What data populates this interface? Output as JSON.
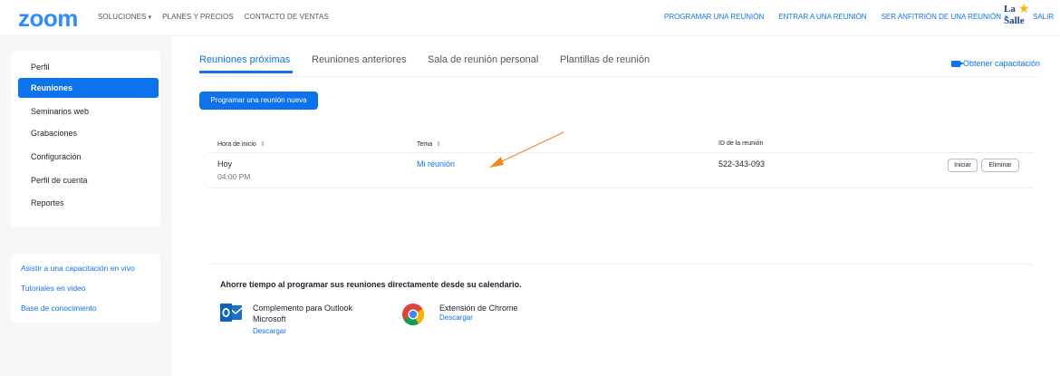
{
  "nav": {
    "logo": "zoom",
    "left": [
      "SOLUCIONES",
      "PLANES Y PRECIOS",
      "CONTACTO DE VENTAS"
    ],
    "right": [
      "PROGRAMAR UNA REUNIÓN",
      "ENTRAR A UNA REUNIÓN",
      "SER ANFITRIÓN DE UNA REUNIÓN"
    ],
    "brand_la": "La",
    "brand_salle": "Salle",
    "logout": "SALIR"
  },
  "sidebar": {
    "items": [
      "Perfil",
      "Reuniones",
      "Seminarios web",
      "Grabaciones",
      "Configuración",
      "Perfil de cuenta",
      "Reportes"
    ],
    "active": "Reuniones",
    "links": [
      "Asistir a una capacitación en vivo",
      "Tutoriales en video",
      "Base de conocimiento"
    ]
  },
  "tabs": [
    "Reuniones próximas",
    "Reuniones anteriores",
    "Sala de reunión personal",
    "Plantillas de reunión"
  ],
  "training_label": "Obtener capacitación",
  "new_meeting_button": "Programar una reunión nueva",
  "table": {
    "headers": [
      "Hora de inicio",
      "Tema",
      "ID de la reunión"
    ],
    "sort_glyph": "⇕",
    "rows": [
      {
        "day": "Hoy",
        "time": "04:00 PM",
        "topic": "Mi reunión",
        "id": "522-343-093",
        "start_label": "Iniciar",
        "delete_label": "Eliminar"
      }
    ]
  },
  "calendar": {
    "title": "Ahorre tiempo al programar sus reuniones directamente desde su calendario.",
    "plugins": [
      {
        "name_line1": "Complemento para Outlook",
        "name_line2": "Microsoft",
        "link": "Descargar"
      },
      {
        "name_line1": "Extensión de Chrome",
        "link": "Descargar"
      }
    ]
  },
  "colors": {
    "accent": "#0e72ed",
    "arrow": "#f08a24",
    "logo": "#2d8cff"
  }
}
